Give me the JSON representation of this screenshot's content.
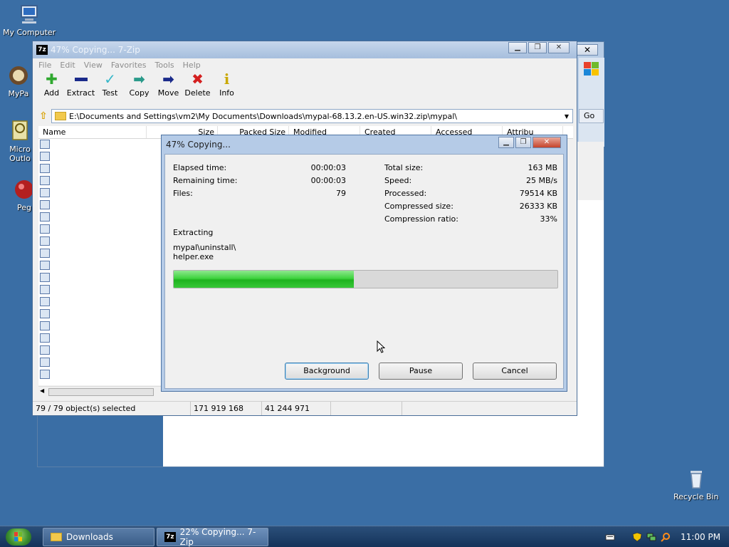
{
  "desktop": {
    "icons": [
      {
        "label": "My Computer"
      },
      {
        "label": "MyPa"
      },
      {
        "label": "Micro\nOutlo"
      },
      {
        "label": "Peg"
      },
      {
        "label": "Recycle Bin"
      }
    ]
  },
  "bg_window": {
    "go_label": "Go"
  },
  "main_window": {
    "title": "47% Copying... 7-Zip",
    "icon_text": "7z",
    "menu": [
      "File",
      "Edit",
      "View",
      "Favorites",
      "Tools",
      "Help"
    ],
    "toolbar": [
      {
        "label": "Add",
        "icon": "add-icon",
        "color": "#2fa82f"
      },
      {
        "label": "Extract",
        "icon": "extract-icon",
        "color": "#1a2a8a"
      },
      {
        "label": "Test",
        "icon": "test-icon",
        "color": "#36b7c9"
      },
      {
        "label": "Copy",
        "icon": "copy-icon",
        "color": "#2a9a8a"
      },
      {
        "label": "Move",
        "icon": "move-icon",
        "color": "#1a2a8a"
      },
      {
        "label": "Delete",
        "icon": "delete-icon",
        "color": "#d42020"
      },
      {
        "label": "Info",
        "icon": "info-icon",
        "color": "#c9a800"
      }
    ],
    "address": "E:\\Documents and Settings\\vm2\\My Documents\\Downloads\\mypal-68.13.2.en-US.win32.zip\\mypal\\",
    "columns": [
      "Name",
      "Size",
      "Packed Size",
      "Modified",
      "Created",
      "Accessed",
      "Attribu"
    ],
    "file_count": 20,
    "status": {
      "selected": "79 / 79 object(s) selected",
      "size": "171 919 168",
      "packed": "41 244 971",
      "extra": ""
    }
  },
  "dialog": {
    "title": "47% Copying...",
    "left_stats": [
      {
        "label": "Elapsed time:",
        "value": "00:00:03"
      },
      {
        "label": "Remaining time:",
        "value": "00:00:03"
      },
      {
        "label": "Files:",
        "value": "79"
      }
    ],
    "right_stats": [
      {
        "label": "Total size:",
        "value": "163 MB"
      },
      {
        "label": "Speed:",
        "value": "25 MB/s"
      },
      {
        "label": "Processed:",
        "value": "79514 KB"
      },
      {
        "label": "Compressed size:",
        "value": "26333 KB"
      },
      {
        "label": "Compression ratio:",
        "value": "33%"
      }
    ],
    "operation": "Extracting",
    "current_file_line1": "mypal\\uninstall\\",
    "current_file_line2": "helper.exe",
    "progress_percent": 47,
    "buttons": {
      "background": "Background",
      "pause": "Pause",
      "cancel": "Cancel"
    }
  },
  "taskbar": {
    "items": [
      {
        "label": "Downloads"
      },
      {
        "label": "22% Copying... 7-Zip"
      }
    ],
    "clock": "11:00 PM"
  }
}
